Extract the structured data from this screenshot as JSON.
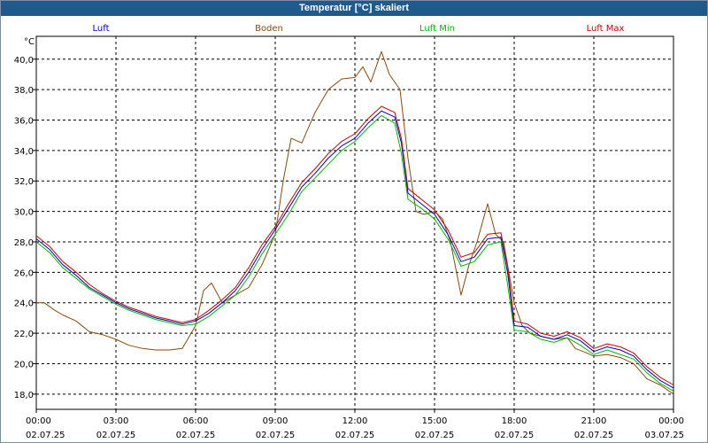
{
  "window": {
    "title": "Temperatur [°C] skaliert"
  },
  "chart_data": {
    "type": "line",
    "title": "Temperatur [°C] skaliert",
    "ylabel": "°C",
    "xlabel": "",
    "ylim": [
      17.0,
      41.5
    ],
    "xlim": [
      "02.07.25 00:00",
      "03.07.25 00:00"
    ],
    "grid": true,
    "legend_position": "top",
    "yticks": [
      "18,0",
      "20,0",
      "22,0",
      "24,0",
      "26,0",
      "28,0",
      "30,0",
      "32,0",
      "34,0",
      "36,0",
      "38,0",
      "40,0"
    ],
    "ytick_values": [
      18,
      20,
      22,
      24,
      26,
      28,
      30,
      32,
      34,
      36,
      38,
      40
    ],
    "xticks": [
      {
        "time": "00:00",
        "date": "02.07.25"
      },
      {
        "time": "03:00",
        "date": "02.07.25"
      },
      {
        "time": "06:00",
        "date": "02.07.25"
      },
      {
        "time": "09:00",
        "date": "02.07.25"
      },
      {
        "time": "12:00",
        "date": "02.07.25"
      },
      {
        "time": "15:00",
        "date": "02.07.25"
      },
      {
        "time": "18:00",
        "date": "02.07.25"
      },
      {
        "time": "21:00",
        "date": "02.07.25"
      },
      {
        "time": "00:00",
        "date": "03.07.25"
      }
    ],
    "xtick_hours": [
      0,
      3,
      6,
      9,
      12,
      15,
      18,
      21,
      24
    ],
    "series": [
      {
        "name": "Luft",
        "color": "#0000cc",
        "points": [
          [
            0,
            28.2
          ],
          [
            0.5,
            27.5
          ],
          [
            1,
            26.5
          ],
          [
            1.5,
            25.8
          ],
          [
            2,
            25.0
          ],
          [
            2.5,
            24.5
          ],
          [
            3,
            24.0
          ],
          [
            3.5,
            23.6
          ],
          [
            4,
            23.3
          ],
          [
            4.5,
            23.0
          ],
          [
            5,
            22.8
          ],
          [
            5.5,
            22.6
          ],
          [
            6,
            22.8
          ],
          [
            6.5,
            23.3
          ],
          [
            7,
            24.0
          ],
          [
            7.5,
            24.8
          ],
          [
            8,
            26.0
          ],
          [
            8.5,
            27.5
          ],
          [
            9,
            28.8
          ],
          [
            9.5,
            30.2
          ],
          [
            10,
            31.6
          ],
          [
            10.5,
            32.5
          ],
          [
            11,
            33.5
          ],
          [
            11.5,
            34.3
          ],
          [
            12,
            34.8
          ],
          [
            12.5,
            35.8
          ],
          [
            13,
            36.6
          ],
          [
            13.5,
            36.2
          ],
          [
            13.75,
            34.5
          ],
          [
            14,
            31.2
          ],
          [
            14.5,
            30.5
          ],
          [
            15,
            29.8
          ],
          [
            15.5,
            28.5
          ],
          [
            16,
            26.7
          ],
          [
            16.5,
            27.0
          ],
          [
            17,
            28.2
          ],
          [
            17.5,
            28.3
          ],
          [
            17.75,
            26.0
          ],
          [
            18,
            22.5
          ],
          [
            18.5,
            22.4
          ],
          [
            19,
            21.8
          ],
          [
            19.5,
            21.6
          ],
          [
            20,
            21.9
          ],
          [
            20.5,
            21.5
          ],
          [
            21,
            20.8
          ],
          [
            21.5,
            21.1
          ],
          [
            22,
            20.9
          ],
          [
            22.5,
            20.5
          ],
          [
            23,
            19.6
          ],
          [
            23.5,
            18.9
          ],
          [
            24,
            18.4
          ]
        ]
      },
      {
        "name": "Boden",
        "color": "#8b4a0b",
        "points": [
          [
            0,
            24.0
          ],
          [
            0.3,
            24.0
          ],
          [
            0.7,
            23.5
          ],
          [
            1,
            23.2
          ],
          [
            1.5,
            22.8
          ],
          [
            2,
            22.1
          ],
          [
            2.5,
            21.9
          ],
          [
            3,
            21.6
          ],
          [
            3.5,
            21.2
          ],
          [
            4,
            21.0
          ],
          [
            4.5,
            20.9
          ],
          [
            5,
            20.9
          ],
          [
            5.5,
            21.0
          ],
          [
            6,
            22.5
          ],
          [
            6.3,
            24.8
          ],
          [
            6.6,
            25.3
          ],
          [
            7,
            24.0
          ],
          [
            7.5,
            24.5
          ],
          [
            8,
            25.0
          ],
          [
            8.5,
            26.5
          ],
          [
            9,
            28.5
          ],
          [
            9.3,
            32.0
          ],
          [
            9.6,
            34.8
          ],
          [
            10,
            34.5
          ],
          [
            10.5,
            36.5
          ],
          [
            11,
            38.0
          ],
          [
            11.5,
            38.7
          ],
          [
            12,
            38.8
          ],
          [
            12.3,
            39.5
          ],
          [
            12.6,
            38.5
          ],
          [
            13,
            40.5
          ],
          [
            13.3,
            39.0
          ],
          [
            13.7,
            38.0
          ],
          [
            14,
            33.5
          ],
          [
            14.3,
            30.0
          ],
          [
            14.6,
            29.8
          ],
          [
            15,
            30.0
          ],
          [
            15.3,
            29.5
          ],
          [
            15.6,
            28.0
          ],
          [
            16,
            24.5
          ],
          [
            16.3,
            26.5
          ],
          [
            16.6,
            28.0
          ],
          [
            17,
            30.5
          ],
          [
            17.3,
            28.5
          ],
          [
            17.6,
            28.0
          ],
          [
            18,
            24.0
          ],
          [
            18.3,
            22.5
          ],
          [
            18.6,
            22.0
          ],
          [
            19,
            21.8
          ],
          [
            19.5,
            21.6
          ],
          [
            20,
            21.7
          ],
          [
            20.3,
            21.0
          ],
          [
            20.6,
            20.8
          ],
          [
            21,
            20.5
          ],
          [
            21.5,
            20.6
          ],
          [
            22,
            20.4
          ],
          [
            22.5,
            20.0
          ],
          [
            23,
            19.0
          ],
          [
            23.5,
            18.6
          ],
          [
            24,
            18.0
          ]
        ]
      },
      {
        "name": "Luft Min",
        "color": "#00bb00",
        "points": [
          [
            0,
            28.0
          ],
          [
            0.5,
            27.3
          ],
          [
            1,
            26.3
          ],
          [
            1.5,
            25.6
          ],
          [
            2,
            24.9
          ],
          [
            2.5,
            24.4
          ],
          [
            3,
            23.9
          ],
          [
            3.5,
            23.5
          ],
          [
            4,
            23.2
          ],
          [
            4.5,
            22.9
          ],
          [
            5,
            22.7
          ],
          [
            5.5,
            22.5
          ],
          [
            6,
            22.6
          ],
          [
            6.5,
            23.1
          ],
          [
            7,
            23.8
          ],
          [
            7.5,
            24.5
          ],
          [
            8,
            25.7
          ],
          [
            8.5,
            27.2
          ],
          [
            9,
            28.5
          ],
          [
            9.5,
            29.8
          ],
          [
            10,
            31.3
          ],
          [
            10.5,
            32.2
          ],
          [
            11,
            33.1
          ],
          [
            11.5,
            34.0
          ],
          [
            12,
            34.6
          ],
          [
            12.5,
            35.5
          ],
          [
            13,
            36.3
          ],
          [
            13.5,
            35.8
          ],
          [
            13.75,
            33.8
          ],
          [
            14,
            30.8
          ],
          [
            14.5,
            30.2
          ],
          [
            15,
            29.5
          ],
          [
            15.5,
            28.2
          ],
          [
            16,
            26.4
          ],
          [
            16.5,
            26.7
          ],
          [
            17,
            27.8
          ],
          [
            17.5,
            28.0
          ],
          [
            17.75,
            25.2
          ],
          [
            18,
            22.2
          ],
          [
            18.5,
            22.1
          ],
          [
            19,
            21.6
          ],
          [
            19.5,
            21.4
          ],
          [
            20,
            21.7
          ],
          [
            20.5,
            21.2
          ],
          [
            21,
            20.6
          ],
          [
            21.5,
            20.9
          ],
          [
            22,
            20.6
          ],
          [
            22.5,
            20.3
          ],
          [
            23,
            19.4
          ],
          [
            23.5,
            18.7
          ],
          [
            24,
            18.2
          ]
        ]
      },
      {
        "name": "Luft Max",
        "color": "#cc0000",
        "points": [
          [
            0,
            28.4
          ],
          [
            0.5,
            27.7
          ],
          [
            1,
            26.7
          ],
          [
            1.5,
            26.0
          ],
          [
            2,
            25.2
          ],
          [
            2.5,
            24.6
          ],
          [
            3,
            24.1
          ],
          [
            3.5,
            23.7
          ],
          [
            4,
            23.4
          ],
          [
            4.5,
            23.1
          ],
          [
            5,
            22.9
          ],
          [
            5.5,
            22.7
          ],
          [
            6,
            22.9
          ],
          [
            6.5,
            23.5
          ],
          [
            7,
            24.2
          ],
          [
            7.5,
            25.0
          ],
          [
            8,
            26.3
          ],
          [
            8.5,
            27.8
          ],
          [
            9,
            29.0
          ],
          [
            9.5,
            30.5
          ],
          [
            10,
            31.9
          ],
          [
            10.5,
            32.8
          ],
          [
            11,
            33.8
          ],
          [
            11.5,
            34.6
          ],
          [
            12,
            35.1
          ],
          [
            12.5,
            36.1
          ],
          [
            13,
            36.9
          ],
          [
            13.5,
            36.5
          ],
          [
            13.75,
            34.8
          ],
          [
            14,
            31.5
          ],
          [
            14.5,
            30.8
          ],
          [
            15,
            30.1
          ],
          [
            15.5,
            28.8
          ],
          [
            16,
            27.0
          ],
          [
            16.5,
            27.3
          ],
          [
            17,
            28.5
          ],
          [
            17.5,
            28.6
          ],
          [
            17.75,
            26.4
          ],
          [
            18,
            22.8
          ],
          [
            18.5,
            22.6
          ],
          [
            19,
            22.0
          ],
          [
            19.5,
            21.8
          ],
          [
            20,
            22.1
          ],
          [
            20.5,
            21.7
          ],
          [
            21,
            21.0
          ],
          [
            21.5,
            21.3
          ],
          [
            22,
            21.1
          ],
          [
            22.5,
            20.7
          ],
          [
            23,
            19.8
          ],
          [
            23.5,
            19.1
          ],
          [
            24,
            18.6
          ]
        ]
      }
    ]
  }
}
